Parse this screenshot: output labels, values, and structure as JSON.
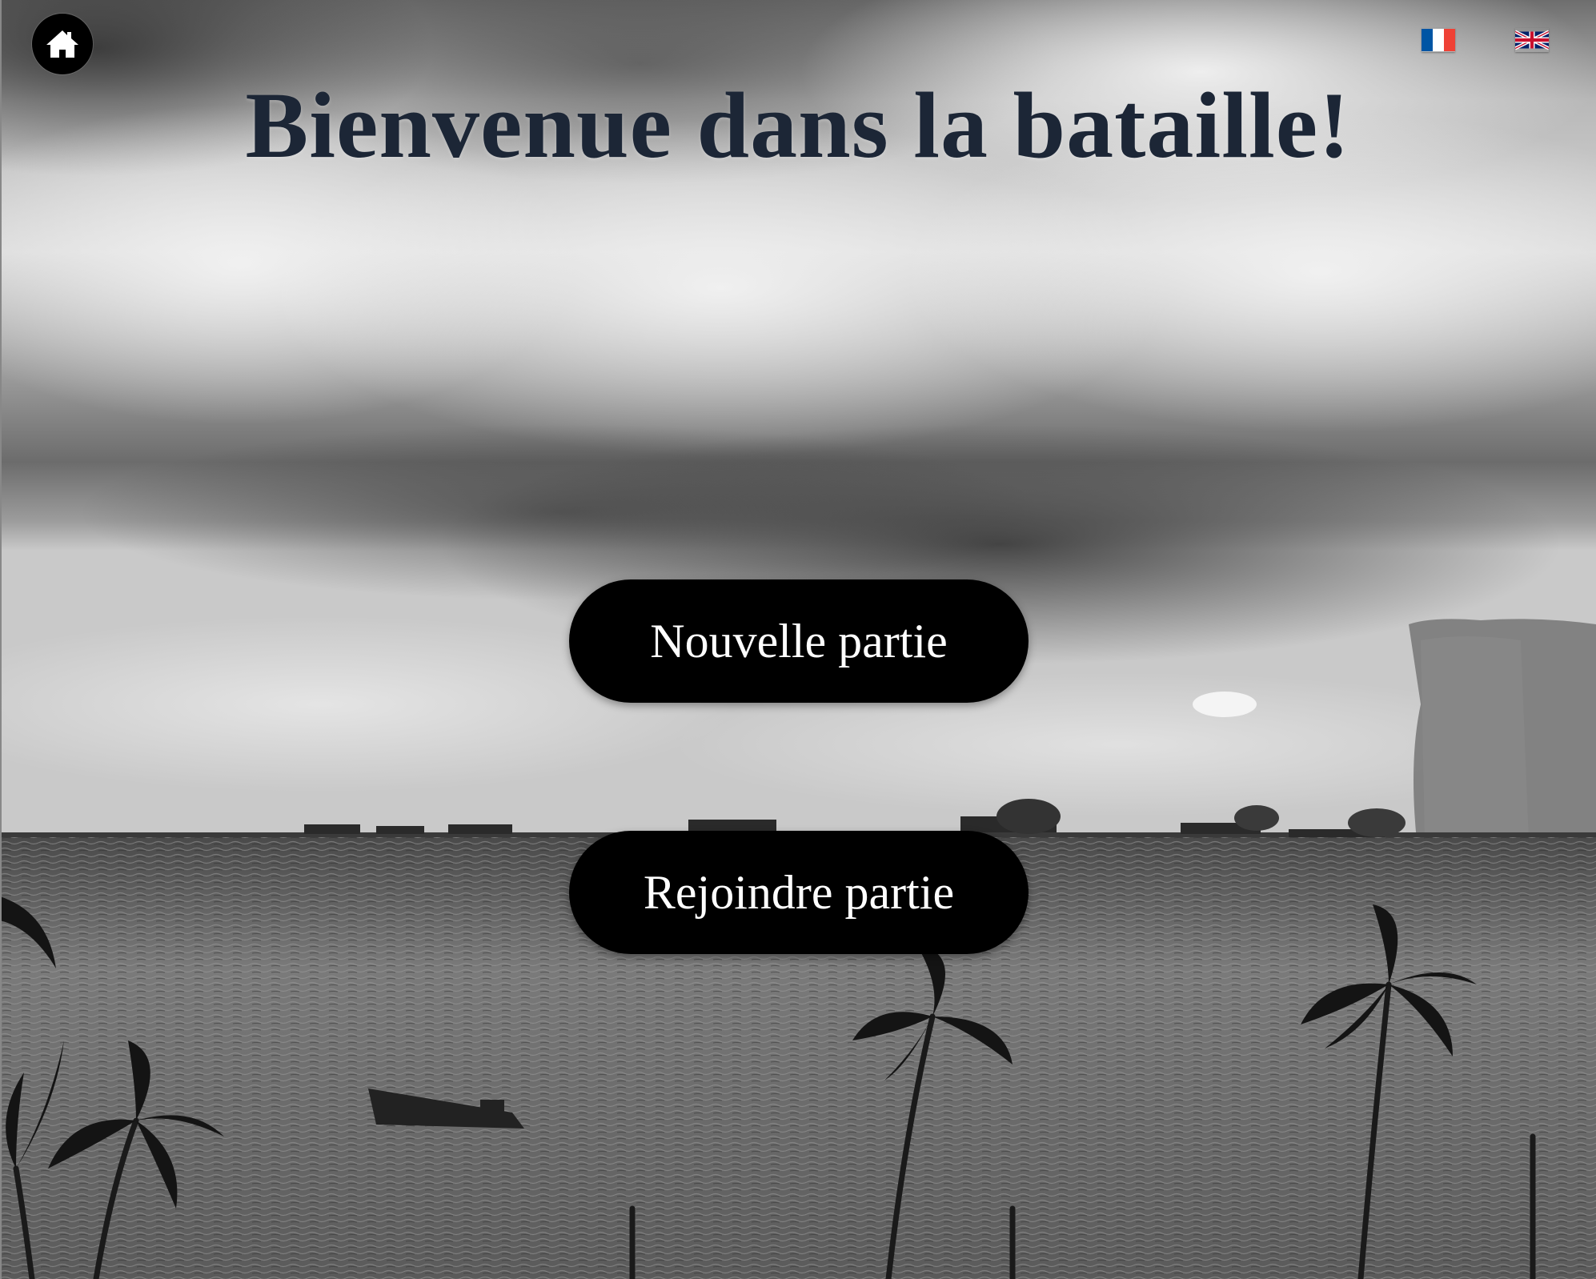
{
  "header": {
    "home_icon": "home-icon",
    "languages": [
      {
        "code": "fr",
        "icon": "french-flag-icon"
      },
      {
        "code": "en",
        "icon": "uk-flag-icon"
      }
    ]
  },
  "main": {
    "title": "Bienvenue dans la bataille!",
    "new_game_label": "Nouvelle partie",
    "join_game_label": "Rejoindre partie"
  },
  "colors": {
    "title": "#1c2636",
    "button_bg": "#000000",
    "button_text": "#ffffff"
  }
}
